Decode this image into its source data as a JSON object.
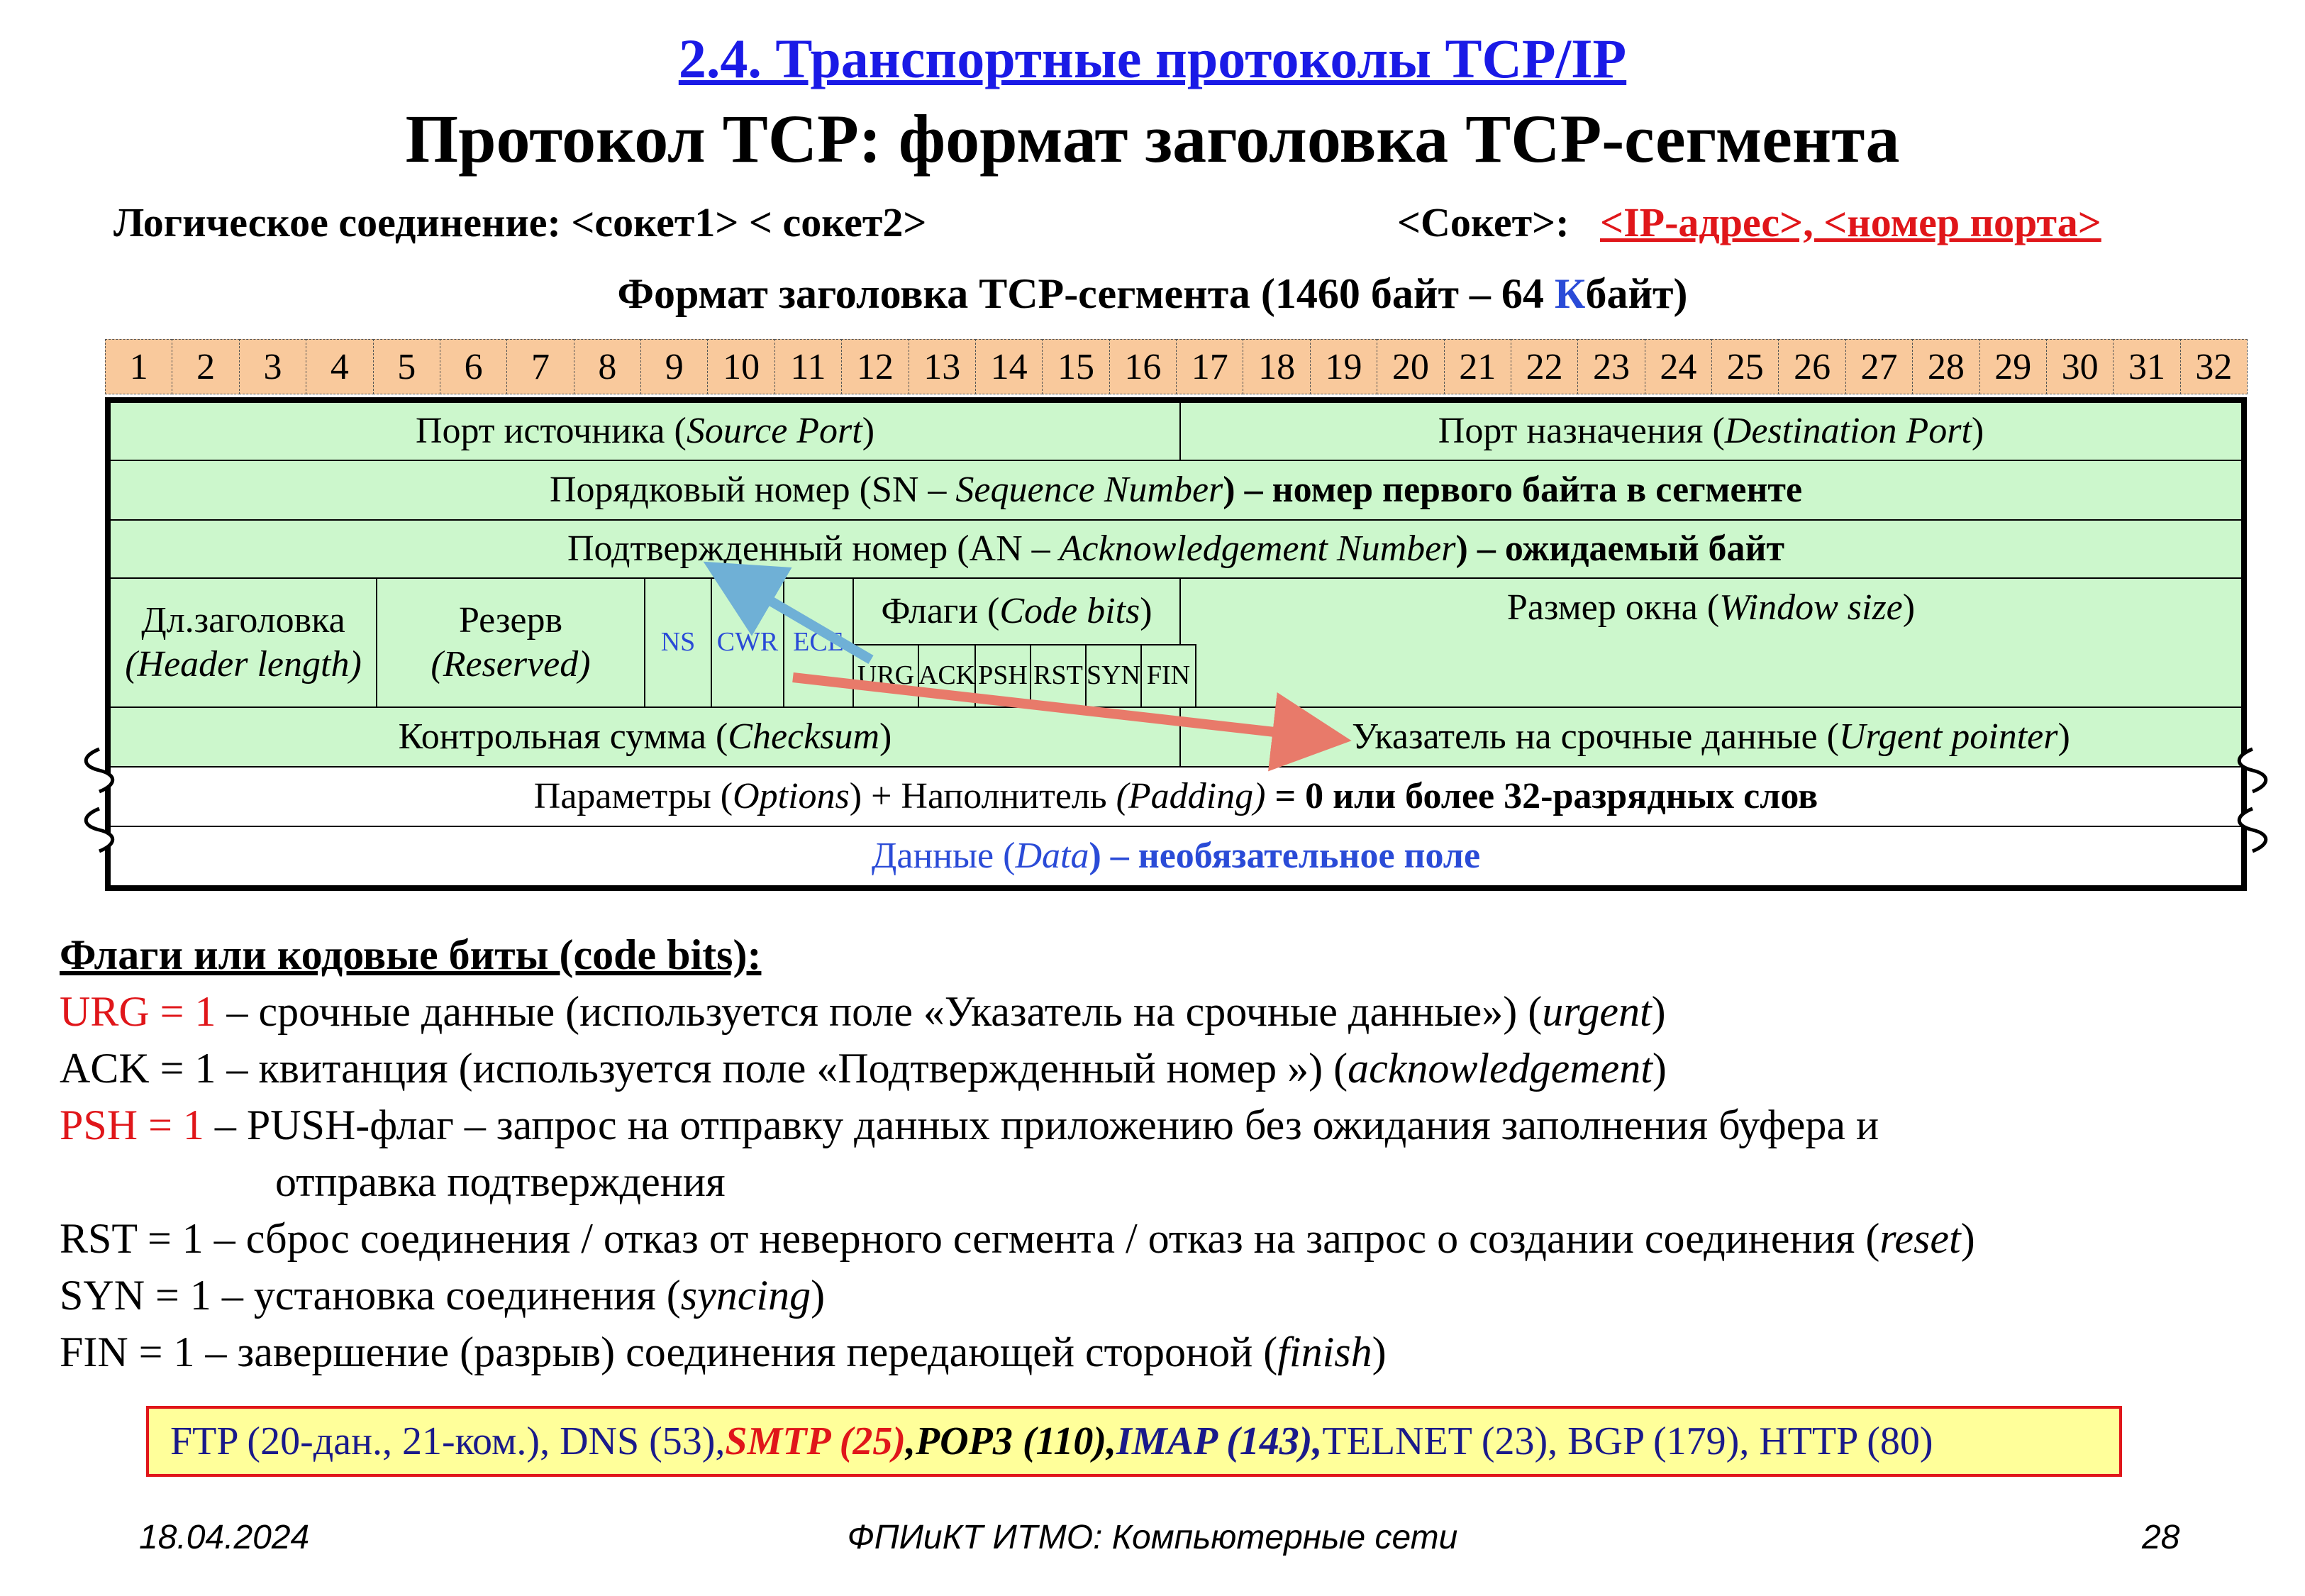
{
  "header": {
    "section_title": "2.4. Транспортные протоколы TCP/IP",
    "main_title": "Протокол  TCP: формат заголовка TCP-сегмента",
    "logical_connection": "Логическое соединение: <сокет1> < сокет2>",
    "socket_label": "<Сокет>:",
    "socket_value": "<IP-адрес>, <номер порта>"
  },
  "format": {
    "title_prefix": "Формат заголовка TCP-сегмента (1460 байт – 64 ",
    "title_k": "К",
    "title_suffix": "байт)",
    "bits": [
      "1",
      "2",
      "3",
      "4",
      "5",
      "6",
      "7",
      "8",
      "9",
      "10",
      "11",
      "12",
      "13",
      "14",
      "15",
      "16",
      "17",
      "18",
      "19",
      "20",
      "21",
      "22",
      "23",
      "24",
      "25",
      "26",
      "27",
      "28",
      "29",
      "30",
      "31",
      "32"
    ],
    "source_port": "Порт источника (",
    "source_port_en": "Source Port",
    "dest_port": "Порт назначения (",
    "dest_port_en": "Destination Port",
    "seq": "Порядковый номер (SN – ",
    "seq_en": "Sequence Number",
    "seq_bold": ") – номер первого байта в сегменте",
    "ack": "Подтвержденный номер (AN – ",
    "ack_en": "Acknowledgement Number",
    "ack_bold": ") – ожидаемый байт",
    "hlen": "Дл.заголовка",
    "hlen_en": "(Header length)",
    "reserved": "Резерв",
    "reserved_en": "(Reserved)",
    "ns": "NS",
    "cwr": "CWR",
    "ece": "ECE",
    "flags": "Флаги (",
    "flags_en": "Code bits",
    "flag_bits": [
      "URG",
      "ACK",
      "PSH",
      "RST",
      "SYN",
      "FIN"
    ],
    "window": "Размер окна (",
    "window_en": "Window size",
    "checksum": "Контрольная сумма (",
    "checksum_en": "Checksum",
    "urgent": "Указатель на срочные данные (",
    "urgent_en": "Urgent pointer",
    "options": "Параметры (",
    "options_en": "Options",
    "options_mid": ") + Наполнитель ",
    "options_pad": "(Padding)",
    "options_bold": " = 0 или более 32-разрядных слов",
    "data": "Данные (",
    "data_en": "Data",
    "data_bold": ") – необязательное поле"
  },
  "flags_list": {
    "heading": "Флаги или кодовые биты (code bits):",
    "urg_key": "URG = 1",
    "urg_text": " – срочные данные (используется поле «Указатель на срочные данные») (",
    "urg_en": "urgent",
    "ack_key": "ACK = 1",
    "ack_text": " – квитанция (используется поле «Подтвержденный номер ») (",
    "ack_en": "acknowledgement",
    "psh_key": "PSH  = 1",
    "psh_text": " – PUSH-флаг – запрос на отправку данных приложению без ожидания заполнения буфера и",
    "psh_text2": "отправка подтверждения",
    "rst_key": "RST  = 1",
    "rst_text": " – сброс соединения / отказ от неверного сегмента / отказ на запрос о создании  соединения (",
    "rst_en": "reset",
    "syn_key": "SYN = 1",
    "syn_text": " – установка соединения (",
    "syn_en": "syncing",
    "fin_key": "FIN  = 1",
    "fin_text": " – завершение (разрыв) соединения передающей стороной (",
    "fin_en": "finish",
    "close": ")"
  },
  "ports": {
    "part1": "FTP (20-дан., 21-ком.), DNS (53), ",
    "smtp": "SMTP (25)",
    "comma": ", ",
    "pop3": "POP3 (110), ",
    "imap": "IMAP (143),",
    "part2": " TELNET (23), BGP (179), HTTP (80)"
  },
  "footer": {
    "date": "18.04.2024",
    "center": "ФПИиКТ ИТМО: Компьютерные сети",
    "page": "28"
  },
  "colors": {
    "header_blue": "#1a1ae6",
    "red": "#e0161a",
    "cell_green": "#ccf7cc",
    "bit_orange": "#f9c99c",
    "arrow_blue": "#6fb0d6",
    "arrow_red": "#e87a6a"
  }
}
